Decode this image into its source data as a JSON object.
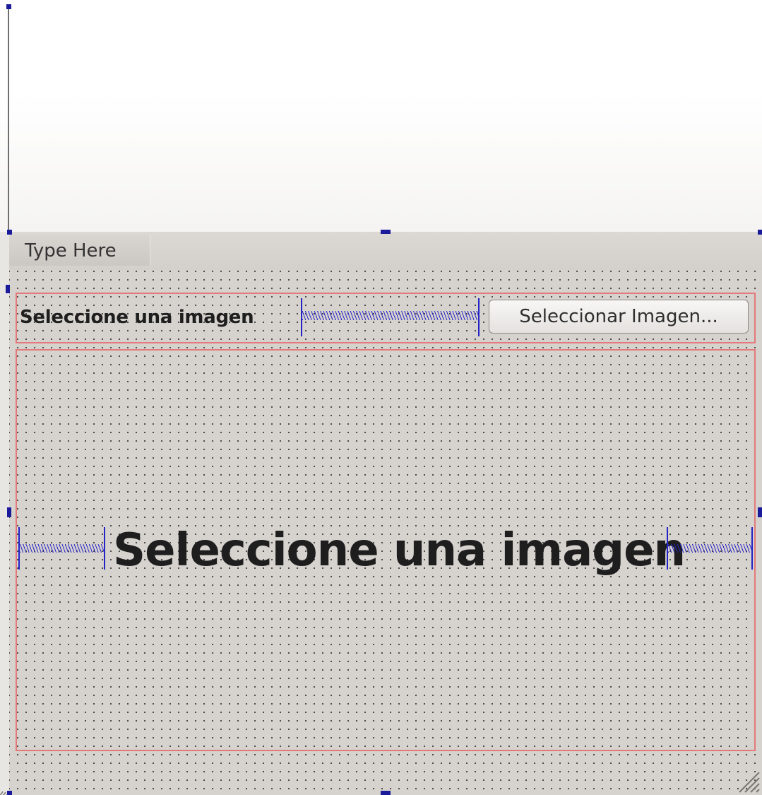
{
  "menubar": {
    "items": [
      {
        "label": "Type Here"
      }
    ]
  },
  "form": {
    "top_row": {
      "label": "Seleccione una imagen",
      "button_label": "Seleccionar Imagen..."
    },
    "main_area": {
      "label": "Seleccione una imagen"
    }
  },
  "colors": {
    "form_background": "#d6d2ce",
    "layout_frame": "#e37979",
    "spacer": "#2323c8",
    "handle": "#1a1a9a"
  }
}
